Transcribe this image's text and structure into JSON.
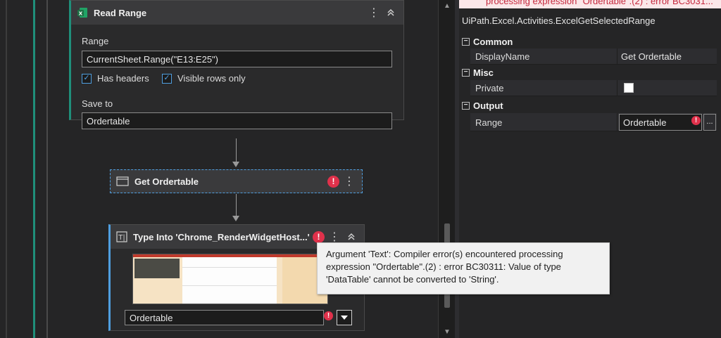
{
  "read_range": {
    "title": "Read Range",
    "range_label": "Range",
    "range_value": "CurrentSheet.Range(\"E13:E25\")",
    "has_headers_label": "Has headers",
    "has_headers_checked": true,
    "visible_rows_label": "Visible rows only",
    "visible_rows_checked": true,
    "save_to_label": "Save to",
    "save_to_value": "Ordertable"
  },
  "get_ordertable": {
    "title": "Get Ordertable",
    "error": "!"
  },
  "type_into": {
    "title": "Type Into 'Chrome_RenderWidgetHost...'",
    "error": "!",
    "text_value": "Ordertable"
  },
  "tooltip": {
    "text": "Argument 'Text': Compiler error(s) encountered processing expression \"Ordertable\".(2) : error BC30311: Value of type 'DataTable' cannot be converted to 'String'."
  },
  "properties": {
    "error_banner": "processing expression \"Ordertable\".(2) : error BC3031...",
    "type_name": "UiPath.Excel.Activities.ExcelGetSelectedRange",
    "categories": [
      {
        "name": "Common",
        "rows": [
          {
            "name": "DisplayName",
            "value": "Get Ordertable"
          }
        ]
      },
      {
        "name": "Misc",
        "rows": [
          {
            "name": "Private",
            "value": ""
          }
        ]
      },
      {
        "name": "Output",
        "rows": [
          {
            "name": "Range",
            "value": "Ordertable",
            "error": "!",
            "ellipsis": "..."
          }
        ]
      }
    ]
  },
  "colors": {
    "accent": "#4f9fe0",
    "error": "#e0314b",
    "excel_green": "#1e7145",
    "teal_rail": "#1f8f7a"
  },
  "icons": {
    "excel": "excel-icon",
    "window": "window-icon",
    "type_into": "type-into-icon",
    "kebab": "kebab-menu-icon",
    "collapse": "collapse-chevron-icon",
    "error": "error-icon",
    "dropdown": "chevron-down-icon"
  }
}
